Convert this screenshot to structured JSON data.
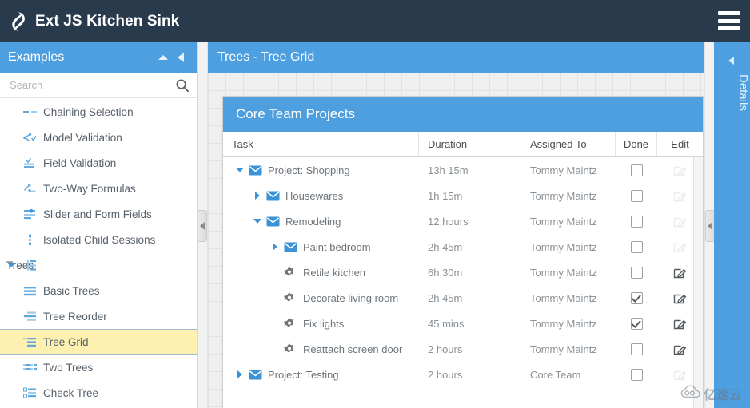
{
  "header": {
    "app_title": "Ext JS Kitchen Sink",
    "logo_icon": "flame-logo-icon",
    "menu_icon": "hamburger-menu-icon"
  },
  "sidebar": {
    "title": "Examples",
    "collapse_up_icon": "triangle-up-icon",
    "collapse_left_icon": "triangle-left-icon",
    "search": {
      "placeholder": "Search",
      "value": "",
      "icon": "search-icon"
    },
    "items": [
      {
        "label": "Chaining Selection",
        "icon": "chaining-selection-icon",
        "type": "leaf",
        "selected": false
      },
      {
        "label": "Model Validation",
        "icon": "model-validation-icon",
        "type": "leaf",
        "selected": false
      },
      {
        "label": "Field Validation",
        "icon": "field-validation-icon",
        "type": "leaf",
        "selected": false
      },
      {
        "label": "Two-Way Formulas",
        "icon": "two-way-formulas-icon",
        "type": "leaf",
        "selected": false
      },
      {
        "label": "Slider and Form Fields",
        "icon": "slider-form-fields-icon",
        "type": "leaf",
        "selected": false
      },
      {
        "label": "Isolated Child Sessions",
        "icon": "isolated-sessions-icon",
        "type": "leaf",
        "selected": false
      },
      {
        "label": "Trees",
        "icon": "trees-group-icon",
        "type": "group",
        "selected": false,
        "expanded": true
      },
      {
        "label": "Basic Trees",
        "icon": "basic-trees-icon",
        "type": "leaf",
        "selected": false
      },
      {
        "label": "Tree Reorder",
        "icon": "tree-reorder-icon",
        "type": "leaf",
        "selected": false
      },
      {
        "label": "Tree Grid",
        "icon": "tree-grid-icon",
        "type": "leaf",
        "selected": true
      },
      {
        "label": "Two Trees",
        "icon": "two-trees-icon",
        "type": "leaf",
        "selected": false
      },
      {
        "label": "Check Tree",
        "icon": "check-tree-icon",
        "type": "leaf",
        "selected": false
      }
    ]
  },
  "content": {
    "header_title": "Trees - Tree Grid",
    "grid": {
      "title": "Core Team Projects",
      "columns": [
        {
          "key": "task",
          "label": "Task"
        },
        {
          "key": "duration",
          "label": "Duration"
        },
        {
          "key": "assigned",
          "label": "Assigned To"
        },
        {
          "key": "done",
          "label": "Done"
        },
        {
          "key": "edit",
          "label": "Edit"
        }
      ],
      "rows": [
        {
          "task": "Project: Shopping",
          "duration": "13h 15m",
          "assigned": "Tommy Maintz",
          "done": false,
          "depth": 0,
          "node": "folder",
          "expander": "down",
          "edit_enabled": false
        },
        {
          "task": "Housewares",
          "duration": "1h 15m",
          "assigned": "Tommy Maintz",
          "done": false,
          "depth": 1,
          "node": "folder",
          "expander": "right",
          "edit_enabled": false
        },
        {
          "task": "Remodeling",
          "duration": "12 hours",
          "assigned": "Tommy Maintz",
          "done": false,
          "depth": 1,
          "node": "folder",
          "expander": "down",
          "edit_enabled": false
        },
        {
          "task": "Paint bedroom",
          "duration": "2h 45m",
          "assigned": "Tommy Maintz",
          "done": false,
          "depth": 2,
          "node": "folder",
          "expander": "right",
          "edit_enabled": false
        },
        {
          "task": "Retile kitchen",
          "duration": "6h 30m",
          "assigned": "Tommy Maintz",
          "done": false,
          "depth": 2,
          "node": "leaf",
          "expander": "none",
          "edit_enabled": true
        },
        {
          "task": "Decorate living room",
          "duration": "2h 45m",
          "assigned": "Tommy Maintz",
          "done": true,
          "depth": 2,
          "node": "leaf",
          "expander": "none",
          "edit_enabled": true
        },
        {
          "task": "Fix lights",
          "duration": "45 mins",
          "assigned": "Tommy Maintz",
          "done": true,
          "depth": 2,
          "node": "leaf",
          "expander": "none",
          "edit_enabled": true
        },
        {
          "task": "Reattach screen door",
          "duration": "2 hours",
          "assigned": "Tommy Maintz",
          "done": false,
          "depth": 2,
          "node": "leaf",
          "expander": "none",
          "edit_enabled": true
        },
        {
          "task": "Project: Testing",
          "duration": "2 hours",
          "assigned": "Core Team",
          "done": false,
          "depth": 0,
          "node": "folder",
          "expander": "right",
          "edit_enabled": false
        }
      ]
    }
  },
  "details_panel": {
    "label": "Details",
    "collapse_icon": "triangle-left-icon"
  },
  "watermark": {
    "text": "亿速云",
    "icon": "cloud-icon"
  },
  "colors": {
    "topbar": "#293a4d",
    "accent_blue": "#4d9fe0",
    "selected_row": "#fdf0b0",
    "folder_icon": "#3a93d8",
    "leaf_icon": "#707070",
    "text_muted": "#8a9196"
  }
}
